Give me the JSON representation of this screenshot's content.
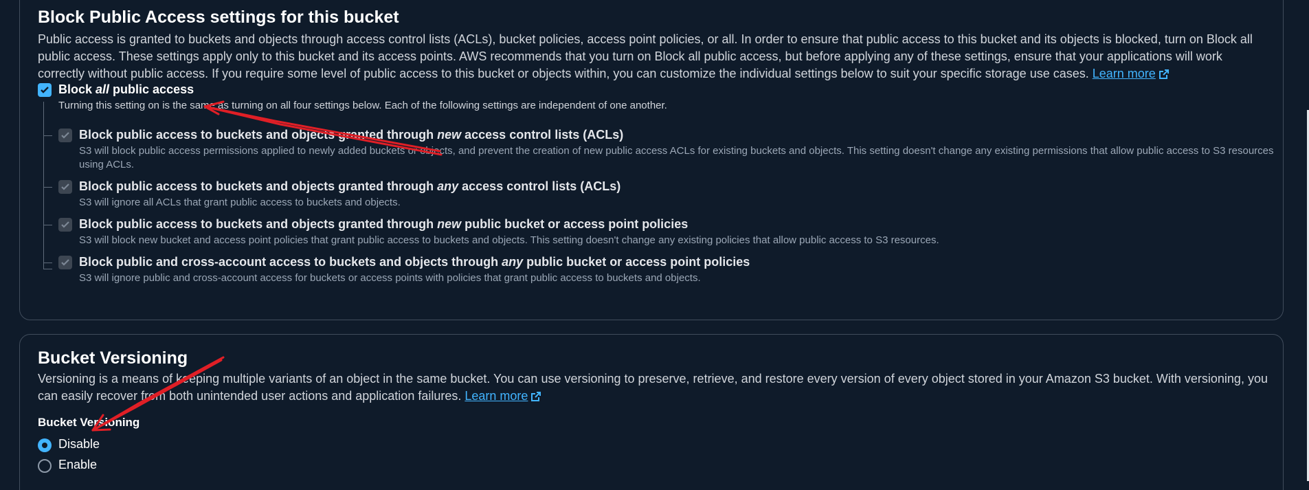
{
  "block_public_access": {
    "title": "Block Public Access settings for this bucket",
    "description": "Public access is granted to buckets and objects through access control lists (ACLs), bucket policies, access point policies, or all. In order to ensure that public access to this bucket and its objects is blocked, turn on Block all public access. These settings apply only to this bucket and its access points. AWS recommends that you turn on Block all public access, but before applying any of these settings, ensure that your applications will work correctly without public access. If you require some level of public access to this bucket or objects within, you can customize the individual settings below to suit your specific storage use cases.",
    "learn_more": "Learn more",
    "block_all": {
      "label_pre": "Block ",
      "label_em": "all",
      "label_post": " public access",
      "description": "Turning this setting on is the same as turning on all four settings below. Each of the following settings are independent of one another.",
      "checked": true
    },
    "options": [
      {
        "label_pre": "Block public access to buckets and objects granted through ",
        "label_em": "new",
        "label_post": " access control lists (ACLs)",
        "description": "S3 will block public access permissions applied to newly added buckets or objects, and prevent the creation of new public access ACLs for existing buckets and objects. This setting doesn't change any existing permissions that allow public access to S3 resources using ACLs.",
        "checked": true
      },
      {
        "label_pre": "Block public access to buckets and objects granted through ",
        "label_em": "any",
        "label_post": " access control lists (ACLs)",
        "description": "S3 will ignore all ACLs that grant public access to buckets and objects.",
        "checked": true
      },
      {
        "label_pre": "Block public access to buckets and objects granted through ",
        "label_em": "new",
        "label_post": " public bucket or access point policies",
        "description": "S3 will block new bucket and access point policies that grant public access to buckets and objects. This setting doesn't change any existing policies that allow public access to S3 resources.",
        "checked": true
      },
      {
        "label_pre": "Block public and cross-account access to buckets and objects through ",
        "label_em": "any",
        "label_post": " public bucket or access point policies",
        "description": "S3 will ignore public and cross-account access for buckets or access points with policies that grant public access to buckets and objects.",
        "checked": true
      }
    ]
  },
  "bucket_versioning": {
    "title": "Bucket Versioning",
    "description": "Versioning is a means of keeping multiple variants of an object in the same bucket. You can use versioning to preserve, retrieve, and restore every version of every object stored in your Amazon S3 bucket. With versioning, you can easily recover from both unintended user actions and application failures.",
    "learn_more": "Learn more",
    "field_label": "Bucket Versioning",
    "options": [
      {
        "label": "Disable",
        "selected": true
      },
      {
        "label": "Enable",
        "selected": false
      }
    ]
  },
  "colors": {
    "background": "#0f1b2a",
    "accent": "#42b4ff",
    "annotation": "#e01f26"
  }
}
